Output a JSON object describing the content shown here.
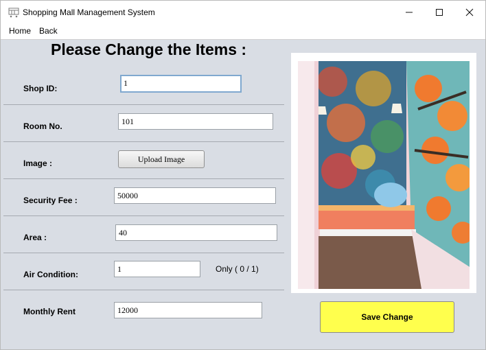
{
  "window": {
    "title": "Shopping Mall Management System",
    "icon": "shopping-cart-icon"
  },
  "menu": {
    "home": "Home",
    "back": "Back"
  },
  "heading": "Please Change the Items :",
  "form": {
    "shop_id": {
      "label": "Shop ID:",
      "value": "1"
    },
    "room_no": {
      "label": "Room No.",
      "value": "101"
    },
    "image": {
      "label": "Image :",
      "button": "Upload Image"
    },
    "security_fee": {
      "label": "Security Fee :",
      "value": "50000"
    },
    "area": {
      "label": "Area :",
      "value": "40"
    },
    "air_condition": {
      "label": "Air Condition:",
      "value": "1",
      "hint": "Only ( 0 / 1)"
    },
    "monthly_rent": {
      "label": "Monthly Rent",
      "value": "12000"
    }
  },
  "save_button": "Save Change",
  "colors": {
    "background": "#d9dde4",
    "save_button": "#ffff4d",
    "focus_border": "#7fa8cf"
  }
}
